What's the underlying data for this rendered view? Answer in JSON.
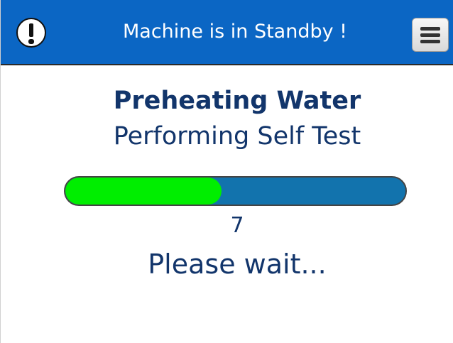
{
  "header": {
    "alert_icon": "exclamation-circle-icon",
    "title": "Machine is in Standby !",
    "menu_icon": "hamburger-menu-icon",
    "background_color": "#0b66c4"
  },
  "status": {
    "title": "Preheating Water",
    "subtitle": "Performing Self Test",
    "progress_fraction": 0.46,
    "progress_value": "7",
    "wait_message": "Please wait...",
    "progress_fill_color": "#00ee00",
    "progress_track_color": "#1273ad",
    "text_color": "#12356b"
  }
}
